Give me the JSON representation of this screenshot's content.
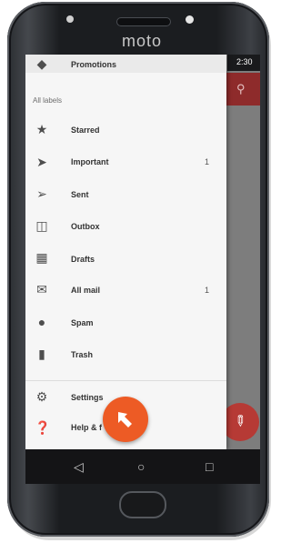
{
  "device": {
    "brand": "moto"
  },
  "status_bar": {
    "time": "2:30"
  },
  "drawer": {
    "header_item": "Promotions",
    "section_label": "All labels",
    "items": [
      {
        "label": "Starred",
        "icon": "star-icon",
        "count": ""
      },
      {
        "label": "Important",
        "icon": "important-icon",
        "count": "1"
      },
      {
        "label": "Sent",
        "icon": "send-icon",
        "count": ""
      },
      {
        "label": "Outbox",
        "icon": "outbox-icon",
        "count": ""
      },
      {
        "label": "Drafts",
        "icon": "drafts-icon",
        "count": ""
      },
      {
        "label": "All mail",
        "icon": "all-mail-icon",
        "count": "1"
      },
      {
        "label": "Spam",
        "icon": "spam-icon",
        "count": ""
      },
      {
        "label": "Trash",
        "icon": "trash-icon",
        "count": ""
      }
    ],
    "footer_items": [
      {
        "label": "Settings",
        "icon": "gear-icon"
      },
      {
        "label": "Help & f",
        "icon": "help-icon"
      }
    ]
  },
  "colors": {
    "accent": "#b63a35",
    "cursor": "#ed5b25"
  }
}
